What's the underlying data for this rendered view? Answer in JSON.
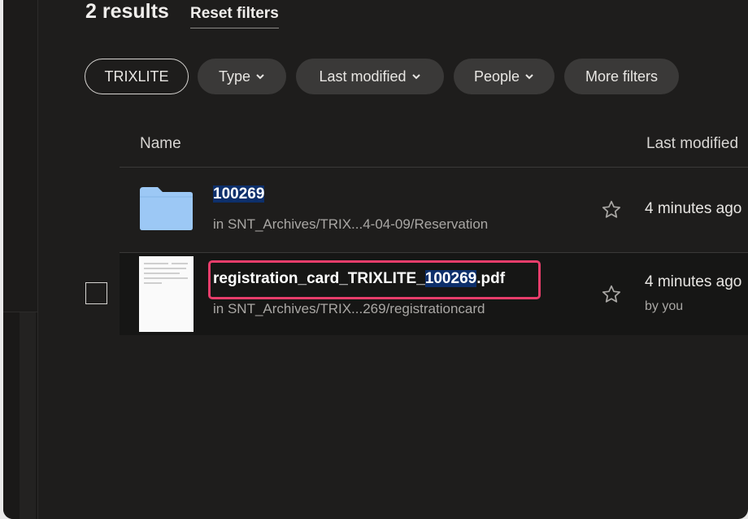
{
  "header": {
    "results_count": "2 results",
    "reset_filters": "Reset filters"
  },
  "filters": [
    {
      "label": "TRIXLITE",
      "dropdown": false,
      "active": true
    },
    {
      "label": "Type",
      "dropdown": true
    },
    {
      "label": "Last modified",
      "dropdown": true
    },
    {
      "label": "People",
      "dropdown": true
    },
    {
      "label": "More filters",
      "dropdown": false
    }
  ],
  "table": {
    "columns": {
      "name": "Name",
      "last_modified": "Last modified"
    },
    "rows": [
      {
        "type": "folder",
        "name": "100269",
        "name_highlight": "100269",
        "path": "in SNT_Archives/TRIX...4-04-09/Reservation",
        "modified": "4 minutes ago",
        "modified_by": ""
      },
      {
        "type": "pdf",
        "name_prefix": "registration_card_TRIXLITE_",
        "name_highlight": "100269",
        "name_suffix": ".pdf",
        "path": "in SNT_Archives/TRIX...269/registrationcard",
        "modified": "4 minutes ago",
        "modified_by": "by you",
        "highlighted_box": true
      }
    ]
  },
  "colors": {
    "background": "#1e1d1c",
    "search_highlight": "#0d2f6b",
    "annotation_box": "#e83d6b",
    "folder": "#9cc8f5"
  }
}
